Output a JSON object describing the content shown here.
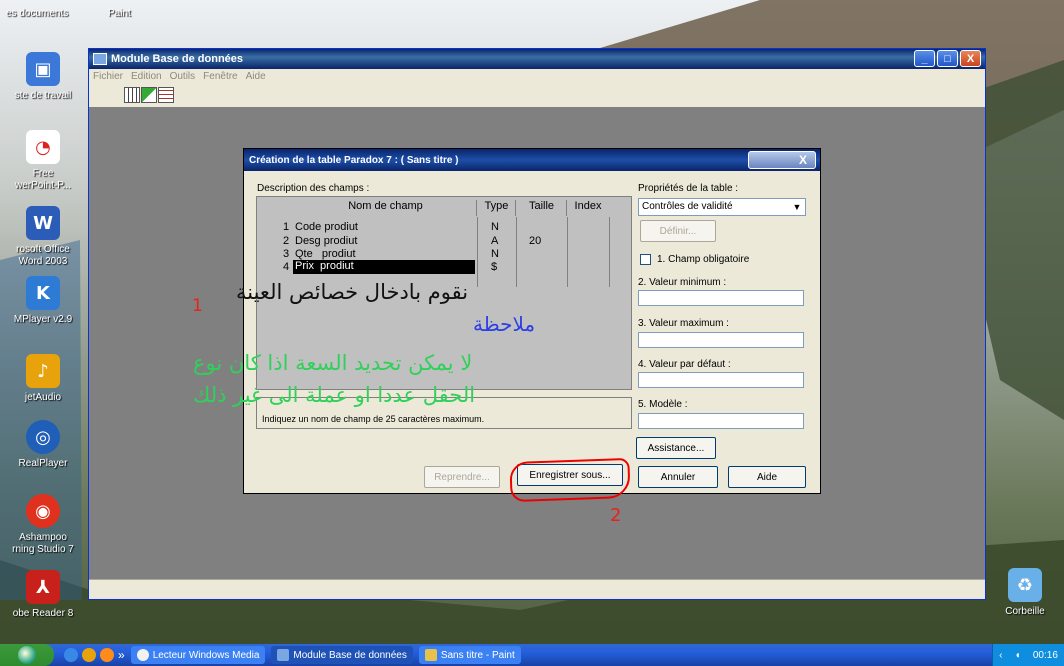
{
  "desktop": {
    "top_labels": [
      "es documents",
      "Paint"
    ],
    "icons": [
      {
        "label": "ste de travail",
        "icon": "computer-icon",
        "color": "#3c78d8"
      },
      {
        "label": "Free\nwerPoint-P...",
        "icon": "powerpoint-converter-icon",
        "color": "#d22"
      },
      {
        "label": "rosoft Office\nWord 2003",
        "icon": "word-icon",
        "color": "#2a5cb8"
      },
      {
        "label": "MPlayer v2.9",
        "icon": "kmplayer-icon",
        "color": "#2e7bd6"
      },
      {
        "label": "jetAudio",
        "icon": "jetaudio-icon",
        "color": "#e8a20c"
      },
      {
        "label": "RealPlayer",
        "icon": "realplayer-icon",
        "color": "#1f5fb8"
      },
      {
        "label": "Ashampoo\nrning Studio 7",
        "icon": "ashampoo-icon",
        "color": "#e0301e"
      },
      {
        "label": "obe Reader 8",
        "icon": "acrobat-icon",
        "color": "#c8201a"
      }
    ],
    "recycle_bin": "Corbeille"
  },
  "main_window": {
    "title": "Module Base de données",
    "menu": [
      "Fichier",
      "Edition",
      "Outils",
      "Fenêtre",
      "Aide"
    ],
    "window_controls": [
      "_",
      "□",
      "X"
    ]
  },
  "dialog": {
    "title": "Création de la table Paradox 7 : ( Sans titre )",
    "close_label": "X",
    "field_desc_label": "Description des champs :",
    "headers": [
      "Nom de champ",
      "Type",
      "Taille",
      "Index"
    ],
    "rows": [
      {
        "num": "1",
        "name": "Code prodiut",
        "type": "N",
        "size": ""
      },
      {
        "num": "2",
        "name": "Desg prodiut",
        "type": "A",
        "size": "20"
      },
      {
        "num": "3",
        "name": "Qte   prodiut",
        "type": "N",
        "size": ""
      },
      {
        "num": "4",
        "name": "Prix  prodiut",
        "type": "$",
        "size": ""
      }
    ],
    "hint": "Indiquez un nom de champ de 25 caractères maximum.",
    "props_label": "Propriétés de la table :",
    "props_select": "Contrôles de validité",
    "define_button": "Définir...",
    "required_checkbox": "1. Champ obligatoire",
    "min_label": "2. Valeur minimum :",
    "max_label": "3. Valeur maximum :",
    "default_label": "4. Valeur par défaut :",
    "model_label": "5. Modèle :",
    "assist_button": "Assistance...",
    "restore_button": "Reprendre...",
    "save_as_button": "Enregistrer sous...",
    "cancel_button": "Annuler",
    "help_button": "Aide"
  },
  "annotations": {
    "num1": "1",
    "num2": "2",
    "arabic_main": "نقوم بادخال خصائص العينة",
    "arabic_note": "ملاحظة",
    "arabic_line1": "لا يمكن تحديد السعة اذا كان نوع",
    "arabic_line2": "الحقل عددا او عملة الى غير ذلك",
    "colors": {
      "red": "#e8221a",
      "blue": "#2b3fe6",
      "green": "#2fd15a",
      "black": "#111111"
    }
  },
  "taskbar": {
    "tasks": [
      {
        "label": "Lecteur Windows Media",
        "icon": "media-player-icon"
      },
      {
        "label": "Module Base de données",
        "icon": "database-icon"
      },
      {
        "label": "Sans titre - Paint",
        "icon": "paint-icon"
      }
    ],
    "overflow": "»",
    "clock": "00:16"
  }
}
